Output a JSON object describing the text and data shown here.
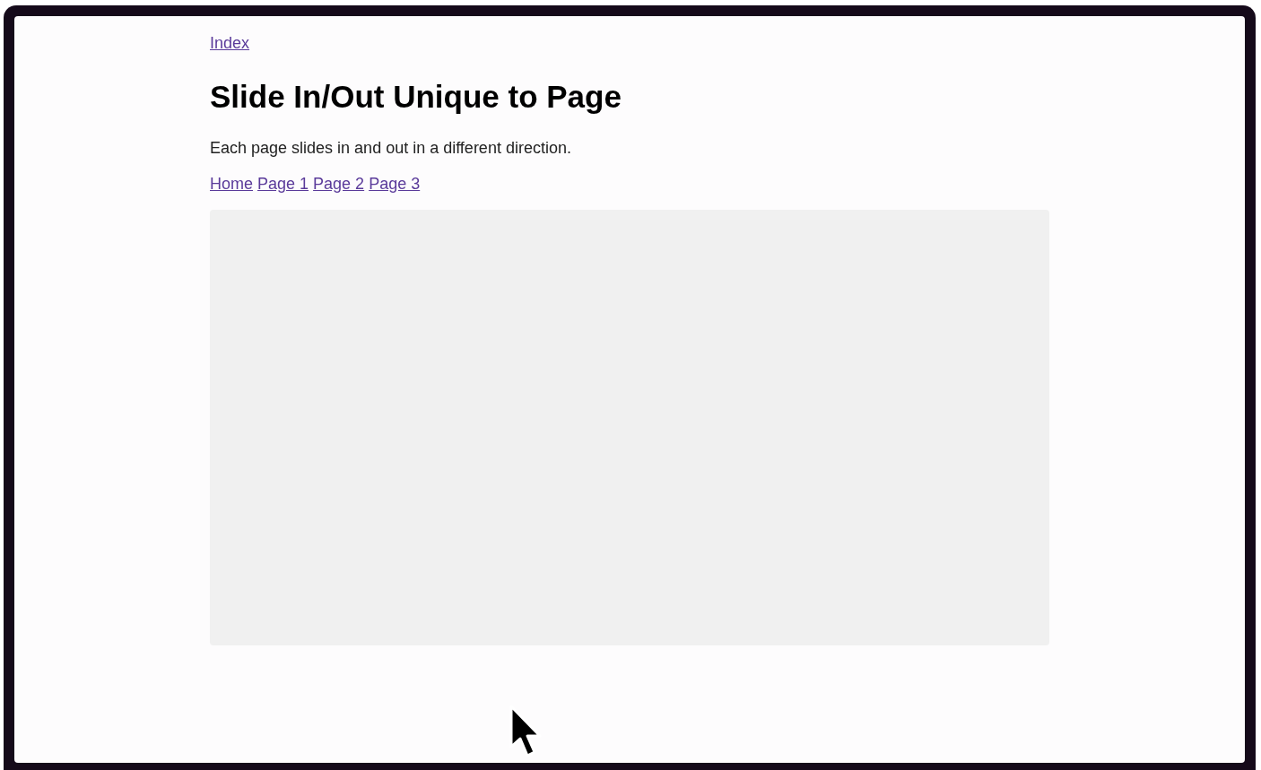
{
  "back_link": "Index",
  "heading": "Slide In/Out Unique to Page",
  "description": "Each page slides in and out in a different direction.",
  "nav_links": [
    "Home",
    "Page 1",
    "Page 2",
    "Page 3"
  ],
  "content_area": {
    "kind": "empty"
  }
}
